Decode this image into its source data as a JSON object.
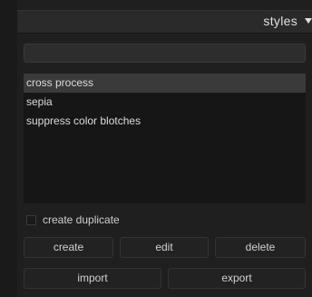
{
  "header": {
    "title": "styles",
    "dropdown_icon": "triangle-down-icon"
  },
  "search": {
    "value": "",
    "placeholder": ""
  },
  "styles_list": {
    "items": [
      {
        "label": "cross process",
        "selected": true
      },
      {
        "label": "sepia",
        "selected": false
      },
      {
        "label": "suppress color blotches",
        "selected": false
      }
    ]
  },
  "options": {
    "create_duplicate_label": "create duplicate",
    "create_duplicate_checked": false
  },
  "buttons": {
    "create": "create",
    "edit": "edit",
    "delete": "delete",
    "import": "import",
    "export": "export"
  },
  "colors": {
    "panel_bg": "#1f1f1f",
    "list_bg": "#161616",
    "selected_bg": "#3a3a3a",
    "text": "#d0d0d0"
  }
}
